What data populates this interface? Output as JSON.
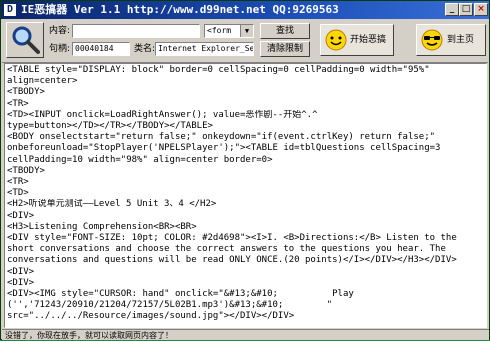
{
  "window": {
    "title": "IE恶搞器 Ver 1.1 http://www.d99net.net  QQ:9269563",
    "icon": "D",
    "min_label": "_",
    "max_label": "□",
    "close_label": "×"
  },
  "toolbar": {
    "content_label": "内容:",
    "content_value": "",
    "handle_label": "句柄:",
    "handle_value": "00040184",
    "class_label": "类名:",
    "class_value": "Internet Explorer_Serve",
    "tag_select_value": "<form",
    "find_label": "查找",
    "clear_label": "清除限制",
    "start_label": "开始恶搞",
    "home_label": "到主页"
  },
  "code_lines": [
    "<TABLE style=\"DISPLAY: block\" border=0 cellSpacing=0 cellPadding=0 width=\"95%\"",
    "align=center>",
    "<TBODY>",
    "<TR>",
    "<TD><INPUT onclick=LoadRightAnswer(); value=恶作剧--开始^.^",
    "type=button></TD></TR></TBODY></TABLE>",
    "<BODY onselectstart=\"return false;\" onkeydown=\"if(event.ctrlKey) return false;\"",
    "onbeforeunload=\"StopPlayer('NPELSPlayer');\"><TABLE id=tblQuestions cellSpacing=3",
    "cellPadding=10 width=\"98%\" align=center border=0>",
    "<TBODY>",
    "<TR>",
    "<TD>",
    "<H2>听说单元测试——Level 5 Unit 3、4 </H2>",
    "<DIV>",
    "<H3>Listening Comprehension<BR><BR>",
    "<DIV style=\"FONT-SIZE: 10pt; COLOR: #2d4698\"><I>I. <B>Directions:</B> Listen to the",
    "short conversations and choose the correct answers to the questions you hear. The",
    "conversations and questions will be read ONLY ONCE.(20 points)</I></DIV></H3></DIV>",
    "<DIV>",
    "<DIV>",
    "<DIV><IMG style=\"CURSOR: hand\" onclick=\"&#13;&#10;          Play",
    "('','71243/20910/21204/72157/5L02B1.mp3')&#13;&#10;        \"",
    "src=\"../../../Resource/images/sound.jpg\"></DIV></DIV>"
  ],
  "status": {
    "text": "没错了，你现在放手，就可以读取网页内容了！"
  },
  "icons": {
    "search": "magnifier-icon",
    "start": "smiley-icon",
    "home": "sunglasses-smiley-icon"
  }
}
